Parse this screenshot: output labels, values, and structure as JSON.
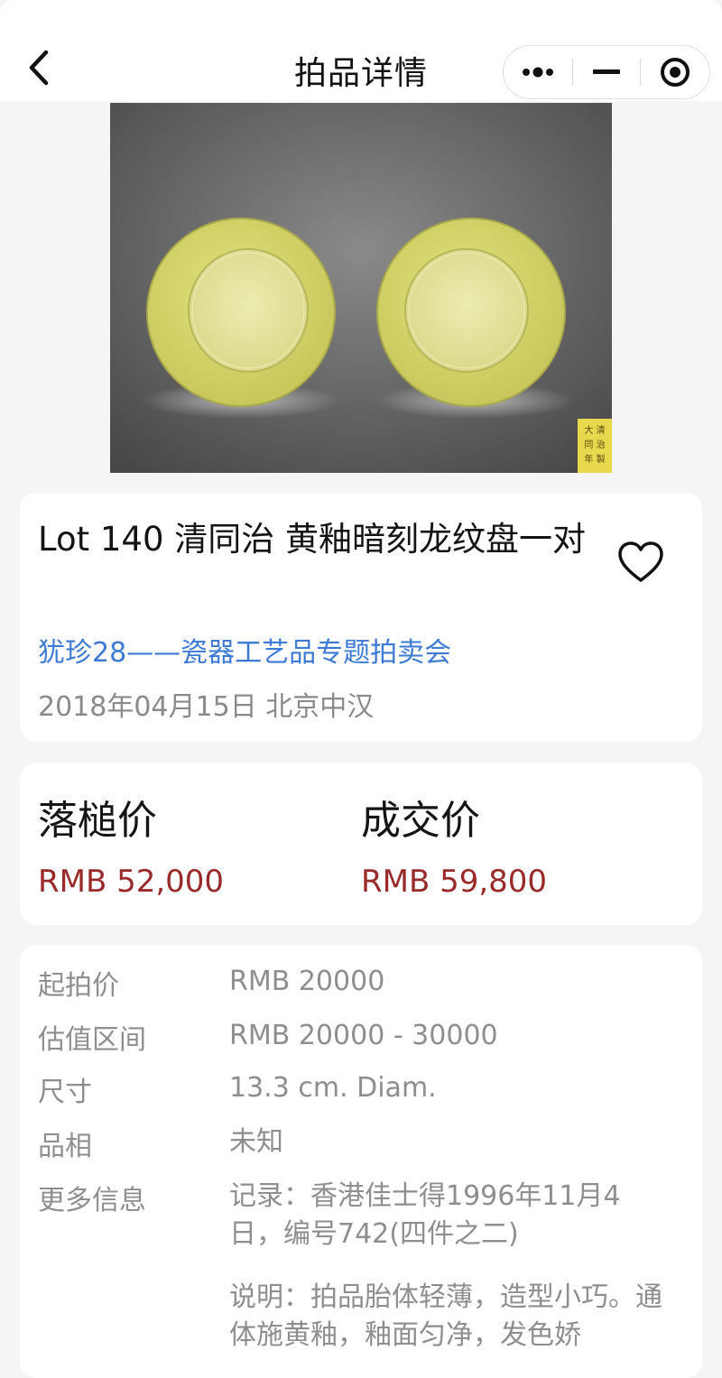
{
  "header": {
    "title": "拍品详情"
  },
  "hero": {
    "seal_text": "大清同治年製"
  },
  "lot": {
    "title": "Lot 140 清同治 黄釉暗刻龙纹盘一对",
    "auction_name": "犹珍28——瓷器工艺品专题拍卖会",
    "date_location": "2018年04月15日 北京中汉"
  },
  "prices": {
    "hammer_label": "落槌价",
    "hammer_value": "RMB 52,000",
    "final_label": "成交价",
    "final_value": "RMB 59,800"
  },
  "info": [
    {
      "label": "起拍价",
      "value": "RMB 20000"
    },
    {
      "label": "估值区间",
      "value": "RMB 20000 - 30000"
    },
    {
      "label": "尺寸",
      "value": "13.3 cm. Diam."
    },
    {
      "label": "品相",
      "value": "未知"
    },
    {
      "label": "更多信息",
      "value": "记录：香港佳士得1996年11月4日，编号742(四件之二)",
      "value2": "说明：拍品胎体轻薄，造型小巧。通体施黄釉，釉面匀净，发色娇"
    }
  ],
  "colors": {
    "link": "#3d7ad6",
    "price": "#9a2a2a",
    "muted": "#8a8a8a",
    "glaze": "#d6d66e"
  },
  "icons": [
    "chevron-left-icon",
    "more-dots-icon",
    "minimize-icon",
    "target-icon",
    "heart-outline-icon"
  ]
}
